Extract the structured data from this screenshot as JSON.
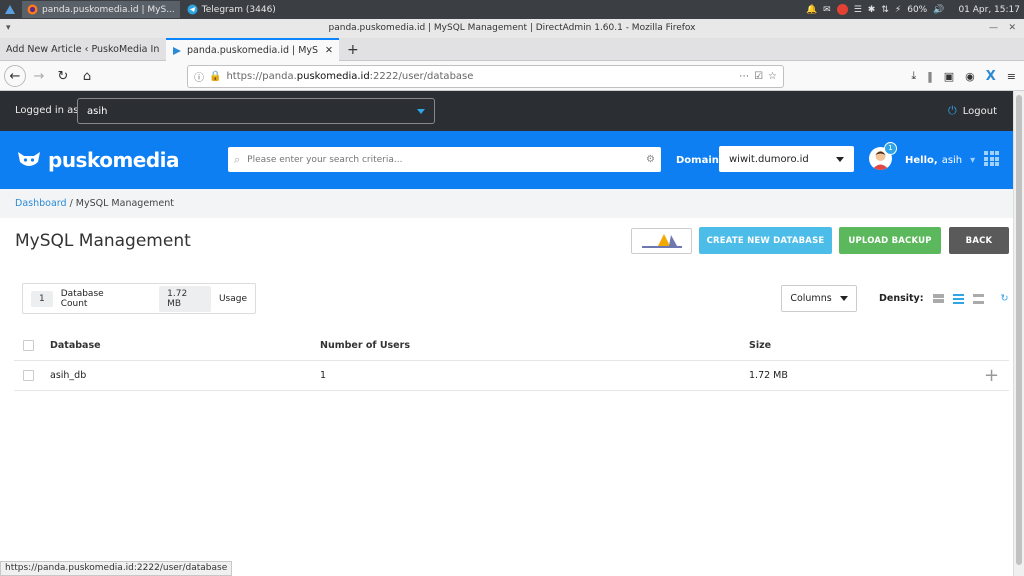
{
  "taskbar": {
    "tasks": [
      {
        "label": "panda.puskomedia.id | MyS..."
      },
      {
        "label": "Telegram (3446)"
      }
    ],
    "battery": "60%",
    "clock": "01 Apr, 15:17"
  },
  "window": {
    "title": "panda.puskomedia.id | MySQL Management | DirectAdmin 1.60.1 - Mozilla Firefox"
  },
  "tabs": [
    {
      "label": "Add New Article ‹ PuskoMedia In"
    },
    {
      "label": "panda.puskomedia.id | MyS"
    }
  ],
  "urlbar": {
    "prefix": "https://panda.",
    "domain": "puskomedia.id",
    "suffix": ":2222/user/database"
  },
  "loginbar": {
    "label": "Logged in as",
    "user": "asih",
    "logout": "Logout"
  },
  "header": {
    "brand": "puskomedia",
    "search_placeholder": "Please enter your search criteria...",
    "domain_label": "Domain",
    "domain_value": "wiwit.dumoro.id",
    "notifications": "1",
    "hello_prefix": "Hello,",
    "hello_user": "asih"
  },
  "breadcrumb": {
    "home": "Dashboard",
    "separator": " / ",
    "current": "MySQL Management"
  },
  "page": {
    "title": "MySQL Management",
    "buttons": {
      "create": "CREATE NEW DATABASE",
      "upload": "UPLOAD BACKUP",
      "back": "BACK"
    }
  },
  "stats": {
    "count_value": "1",
    "count_label": "Database Count",
    "usage_value": "1.72 MB",
    "usage_label": "Usage"
  },
  "controls": {
    "columns": "Columns",
    "density": "Density:"
  },
  "table": {
    "headers": {
      "database": "Database",
      "users": "Number of Users",
      "size": "Size"
    },
    "rows": [
      {
        "database": "asih_db",
        "users": "1",
        "size": "1.72 MB"
      }
    ]
  },
  "status_url": "https://panda.puskomedia.id:2222/user/database",
  "colors": {
    "brand_blue": "#0d7ff2",
    "create_btn": "#4bbde8",
    "upload_btn": "#5cb85c",
    "back_btn": "#5a5a5a"
  }
}
